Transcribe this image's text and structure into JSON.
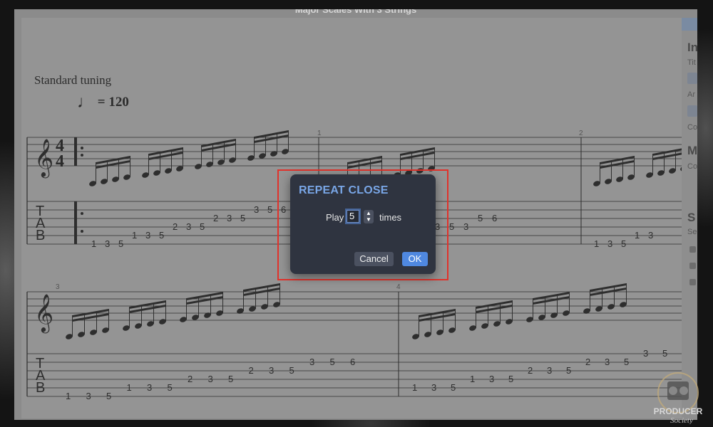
{
  "window": {
    "title": "Major Scales With 3 Strings"
  },
  "score": {
    "tuning": "Standard tuning",
    "tempo_symbol": "♩",
    "tempo_text": "= 120",
    "time_signature": "4/4",
    "measure_numbers": [
      "1",
      "2",
      "3",
      "4"
    ],
    "tab_label": [
      "T",
      "A",
      "B"
    ],
    "tab_row1": {
      "bar1": [
        "1",
        "3",
        "5",
        "1",
        "3",
        "5",
        "2",
        "3",
        "5",
        "2",
        "3",
        "5",
        "3",
        "5",
        "6"
      ],
      "bar2": [
        "3",
        "5",
        "3",
        "5",
        "6"
      ],
      "bar3": [
        "1",
        "3",
        "5",
        "1",
        "3"
      ]
    },
    "tab_row2": {
      "bar1": [
        "1",
        "3",
        "5",
        "1",
        "3",
        "5",
        "2",
        "3",
        "5",
        "2",
        "3",
        "5",
        "3",
        "5",
        "6"
      ],
      "bar2": [
        "1",
        "3",
        "5",
        "1",
        "3",
        "5",
        "2",
        "3",
        "5",
        "2",
        "3",
        "5",
        "3",
        "5"
      ]
    }
  },
  "side_panel": {
    "headings": [
      "In",
      "M",
      "S"
    ],
    "labels": [
      "Tit",
      "Ar",
      "Co",
      "Co",
      "Se"
    ]
  },
  "dialog": {
    "title": "REPEAT CLOSE",
    "play_label": "Play",
    "repeat_value": "5",
    "times_label": "times",
    "cancel_label": "Cancel",
    "ok_label": "OK"
  },
  "watermark": {
    "text_line1": "PRODUCER",
    "text_line2": "Society"
  },
  "colors": {
    "dialog_bg": "#2f3440",
    "dialog_title": "#79a6e6",
    "ok_button": "#4f88e0",
    "highlight_border": "#e0322b"
  }
}
